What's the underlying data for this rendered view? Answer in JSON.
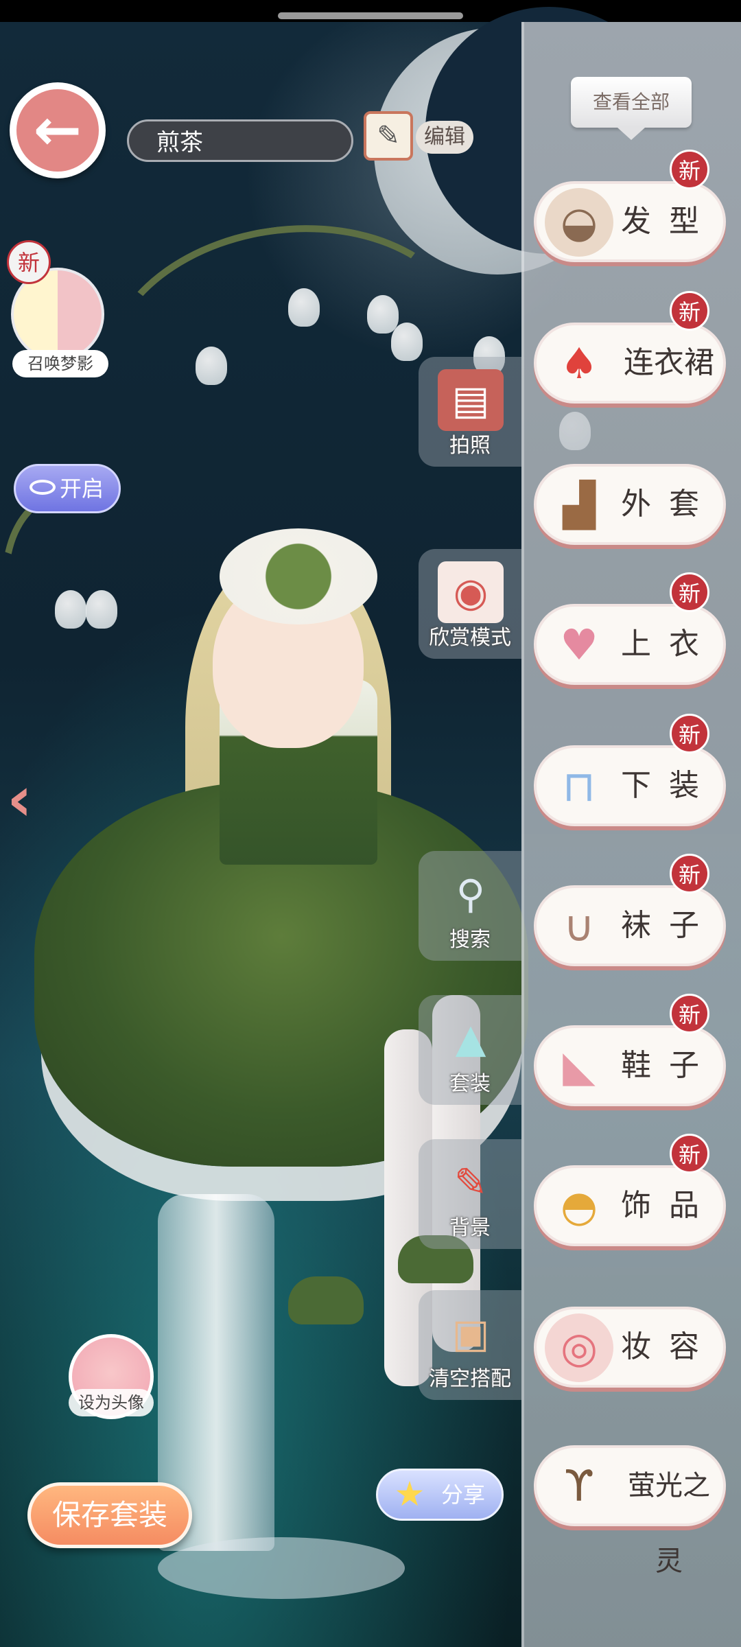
{
  "header": {
    "outfit_name": "煎茶",
    "edit_label": "编辑"
  },
  "left": {
    "summon_label": "召唤梦影",
    "summon_badge": "新",
    "toggle_label": "开启",
    "set_avatar_label": "设为头像",
    "save_label": "保存套装",
    "share_label": "分享"
  },
  "tools": [
    {
      "label": "拍照",
      "icon": "notebook-photo-icon"
    },
    {
      "label": "欣赏模式",
      "icon": "camera-heart-icon"
    },
    {
      "label": "搜索",
      "icon": "magnifier-icon"
    },
    {
      "label": "套装",
      "icon": "outfit-set-icon"
    },
    {
      "label": "背景",
      "icon": "paint-brush-icon"
    },
    {
      "label": "清空搭配",
      "icon": "clear-box-icon"
    }
  ],
  "panel": {
    "view_all": "查看全部",
    "categories": [
      {
        "label": "发型",
        "icon": "hair-icon",
        "badge": "新"
      },
      {
        "label": "连衣裙",
        "icon": "dress-icon",
        "badge": "新"
      },
      {
        "label": "外套",
        "icon": "coat-icon",
        "badge": ""
      },
      {
        "label": "上衣",
        "icon": "top-icon",
        "badge": "新"
      },
      {
        "label": "下装",
        "icon": "shorts-icon",
        "badge": "新"
      },
      {
        "label": "袜子",
        "icon": "socks-icon",
        "badge": "新"
      },
      {
        "label": "鞋子",
        "icon": "heels-icon",
        "badge": "新"
      },
      {
        "label": "饰品",
        "icon": "hat-icon",
        "badge": "新"
      },
      {
        "label": "妆容",
        "icon": "compact-icon",
        "badge": ""
      },
      {
        "label": "萤光之灵",
        "icon": "branch-icon",
        "badge": ""
      }
    ]
  },
  "colors": {
    "accent_pink": "#e28785",
    "badge_red": "#c2333b",
    "save_orange": "#f58c62"
  }
}
